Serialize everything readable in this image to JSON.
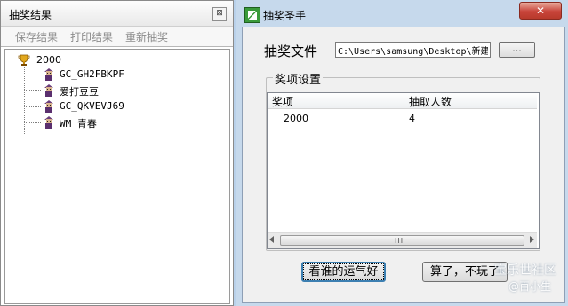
{
  "left_panel": {
    "title": "抽奖结果",
    "close_glyph": "⊠",
    "toolbar": [
      "保存结果",
      "打印结果",
      "重新抽奖"
    ],
    "tree": {
      "root": "2000",
      "items": [
        "GC_GH2FBKPF",
        "爱打豆豆",
        "GC_QKVEVJ69",
        "WM_青春"
      ]
    }
  },
  "dialog": {
    "title": "抽奖圣手",
    "close_glyph": "✕",
    "file_label": "抽奖文件",
    "file_path": "C:\\Users\\samsung\\Desktop\\新建",
    "browse_label": "...",
    "group_label": "奖项设置",
    "columns": [
      "奖项",
      "抽取人数"
    ],
    "rows": [
      {
        "prize": "2000",
        "count": "4"
      }
    ],
    "scroll_grip": "III",
    "lucky_button": "看谁的运气好",
    "quit_button": "算了，不玩了"
  },
  "watermark": {
    "line1": "宝乐世社区",
    "line2": "@百小生"
  }
}
